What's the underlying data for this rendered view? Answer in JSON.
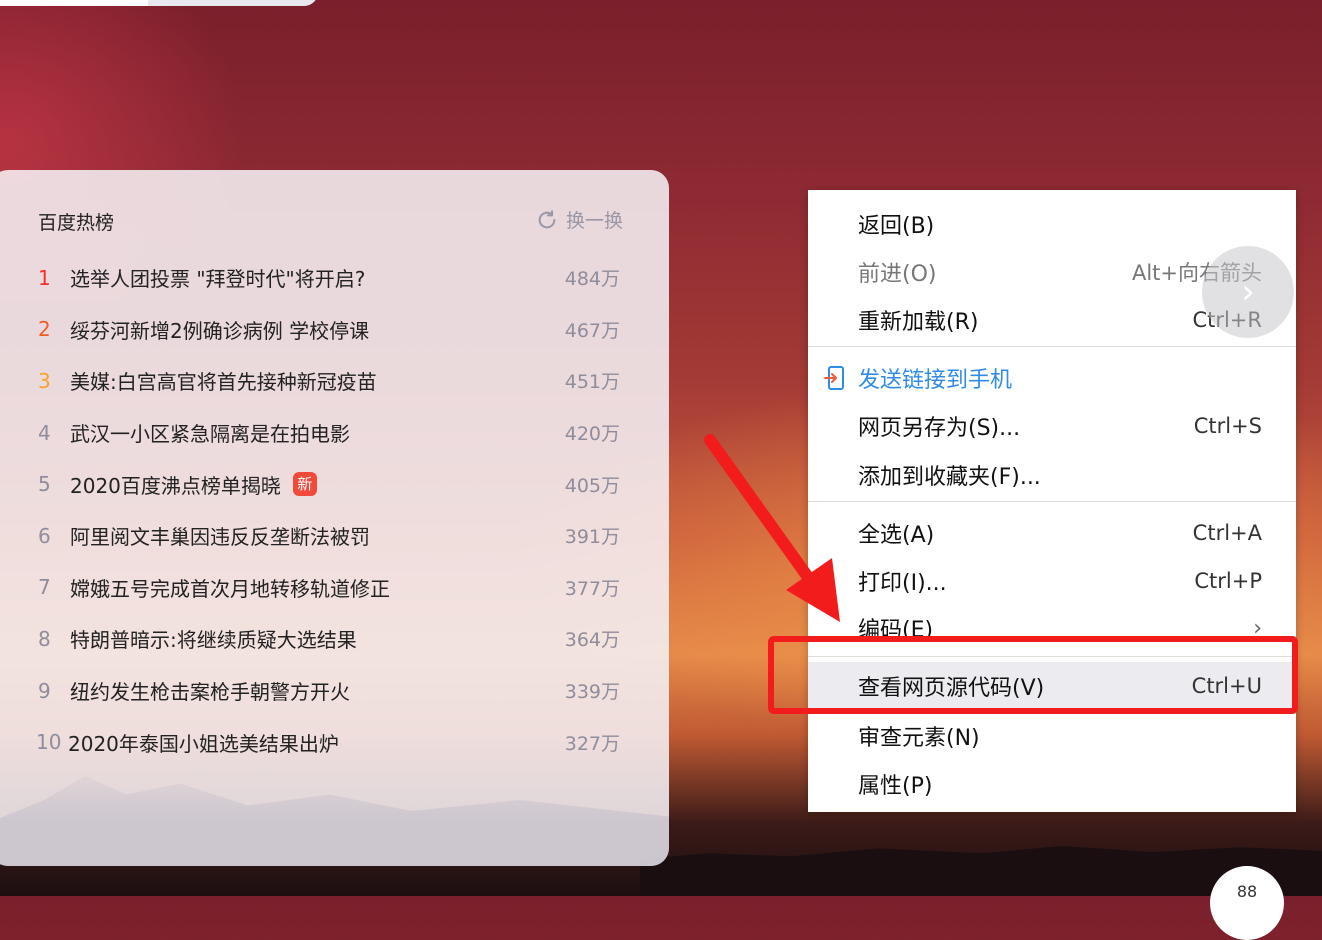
{
  "hot_list": {
    "title": "百度热榜",
    "refresh_label": "换一换",
    "items": [
      {
        "rank": "1",
        "title": "选举人团投票 \"拜登时代\"将开启?",
        "count": "484万"
      },
      {
        "rank": "2",
        "title": "绥芬河新增2例确诊病例 学校停课",
        "count": "467万"
      },
      {
        "rank": "3",
        "title": "美媒:白宫高官将首先接种新冠疫苗",
        "count": "451万"
      },
      {
        "rank": "4",
        "title": "武汉一小区紧急隔离是在拍电影",
        "count": "420万"
      },
      {
        "rank": "5",
        "title": "2020百度沸点榜单揭晓",
        "count": "405万",
        "badge": "新"
      },
      {
        "rank": "6",
        "title": "阿里阅文丰巢因违反反垄断法被罚",
        "count": "391万"
      },
      {
        "rank": "7",
        "title": "嫦娥五号完成首次月地转移轨道修正",
        "count": "377万"
      },
      {
        "rank": "8",
        "title": "特朗普暗示:将继续质疑大选结果",
        "count": "364万"
      },
      {
        "rank": "9",
        "title": "纽约发生枪击案枪手朝警方开火",
        "count": "339万"
      },
      {
        "rank": "10",
        "title": "2020年泰国小姐选美结果出炉",
        "count": "327万"
      }
    ]
  },
  "context_menu": {
    "back": {
      "label": "返回(B)"
    },
    "forward": {
      "label": "前进(O)",
      "shortcut": "Alt+向右箭头"
    },
    "reload": {
      "label": "重新加载(R)",
      "shortcut": "Ctrl+R"
    },
    "send": {
      "label": "发送链接到手机"
    },
    "save_as": {
      "label": "网页另存为(S)...",
      "shortcut": "Ctrl+S"
    },
    "favorite": {
      "label": "添加到收藏夹(F)..."
    },
    "select_all": {
      "label": "全选(A)",
      "shortcut": "Ctrl+A"
    },
    "print": {
      "label": "打印(I)...",
      "shortcut": "Ctrl+P"
    },
    "encoding": {
      "label": "编码(E)",
      "submenu": "›"
    },
    "view_source": {
      "label": "查看网页源代码(V)",
      "shortcut": "Ctrl+U"
    },
    "inspect": {
      "label": "审查元素(N)"
    },
    "properties": {
      "label": "属性(P)"
    }
  },
  "nav_next": "›",
  "corner_button": "88",
  "colors": {
    "highlight": "#f31c1c",
    "menu_link": "#2f8be8"
  }
}
